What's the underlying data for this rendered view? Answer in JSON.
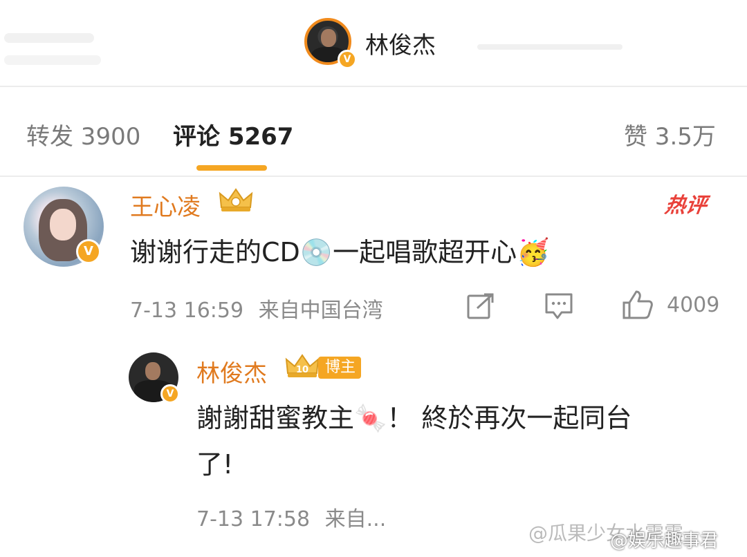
{
  "header": {
    "user_name": "林俊杰",
    "verified_badge": "V"
  },
  "tabs": [
    {
      "label": "转发 3900"
    },
    {
      "label": "评论 5267"
    },
    {
      "label": "赞 3.5万"
    }
  ],
  "comment": {
    "author": "王心凌",
    "hot_tag": "热评",
    "text": "谢谢行走的CD💿一起唱歌超开心🥳",
    "time": "7-13 16:59",
    "location": "来自中国台湾",
    "like_count": "4009"
  },
  "reply": {
    "author": "林俊杰",
    "crown_level": "10",
    "role_badge": "博主",
    "text_line1": "謝謝甜蜜教主🍬！ 終於再次一起同台",
    "text_line2": "了!",
    "time": "7-13 17:58",
    "location": "来自..."
  },
  "watermarks": {
    "line1": "@瓜果少女水震震",
    "line2": "@娱乐趣事君"
  },
  "icons": {
    "share": "share-icon",
    "comment": "comment-icon",
    "like": "thumbs-up-icon"
  },
  "colors": {
    "accent": "#f5a623",
    "name_orange": "#e07a1f",
    "hot_red": "#e9413a"
  }
}
